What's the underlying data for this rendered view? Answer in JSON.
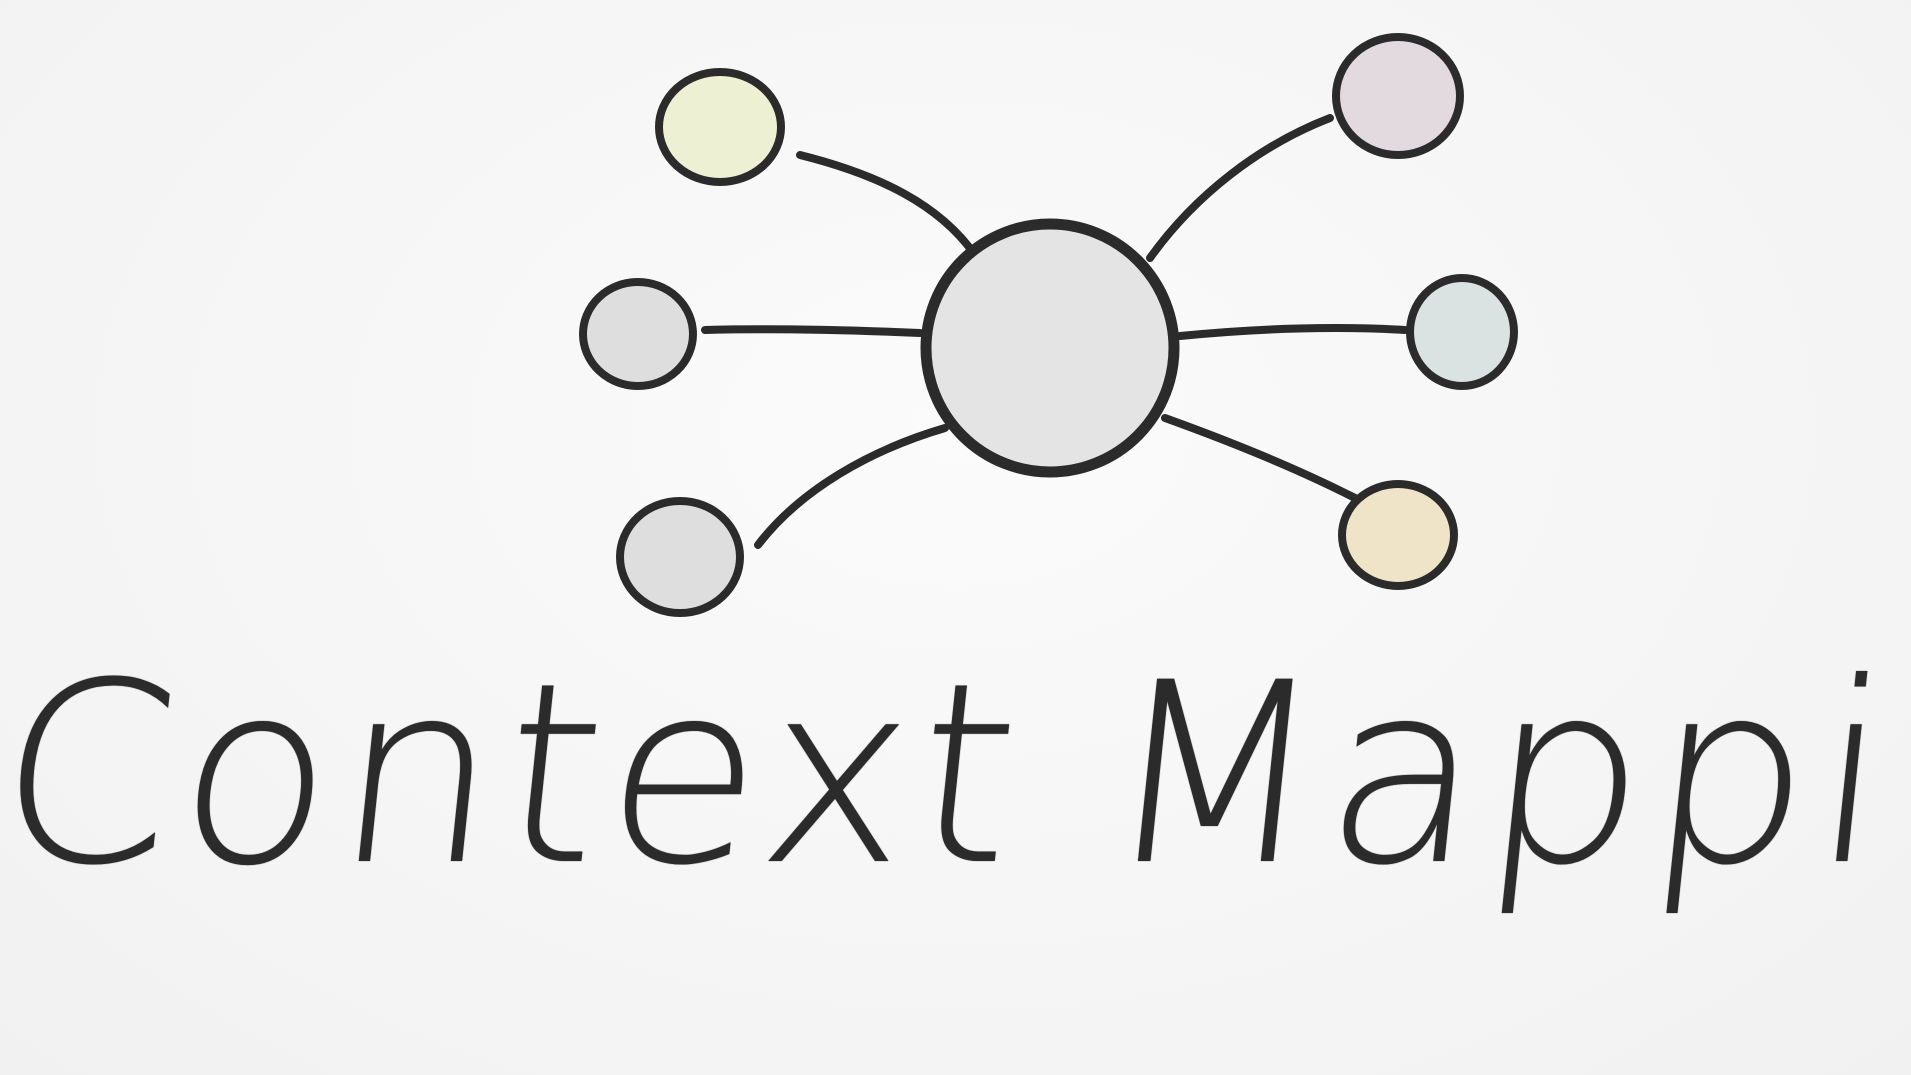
{
  "diagram": {
    "title": "Context Mapping",
    "colors": {
      "stroke": "#2b2b2b",
      "center_fill": "#e4e4e4",
      "node_yellow": "#eef0d4",
      "node_gray": "#dedede",
      "node_mauve": "#e2dadf",
      "node_blue_gray": "#dbe2e2",
      "node_peach": "#efe3c8"
    },
    "nodes": [
      {
        "id": "center",
        "role": "center",
        "color": "center_fill"
      },
      {
        "id": "top-left",
        "role": "satellite",
        "color": "node_yellow"
      },
      {
        "id": "mid-left",
        "role": "satellite",
        "color": "node_gray"
      },
      {
        "id": "bottom-left",
        "role": "satellite",
        "color": "node_gray"
      },
      {
        "id": "top-right",
        "role": "satellite",
        "color": "node_mauve"
      },
      {
        "id": "mid-right",
        "role": "satellite",
        "color": "node_blue_gray"
      },
      {
        "id": "bottom-right",
        "role": "satellite",
        "color": "node_peach"
      }
    ],
    "edges": [
      [
        "center",
        "top-left"
      ],
      [
        "center",
        "mid-left"
      ],
      [
        "center",
        "bottom-left"
      ],
      [
        "center",
        "top-right"
      ],
      [
        "center",
        "mid-right"
      ],
      [
        "center",
        "bottom-right"
      ]
    ]
  }
}
